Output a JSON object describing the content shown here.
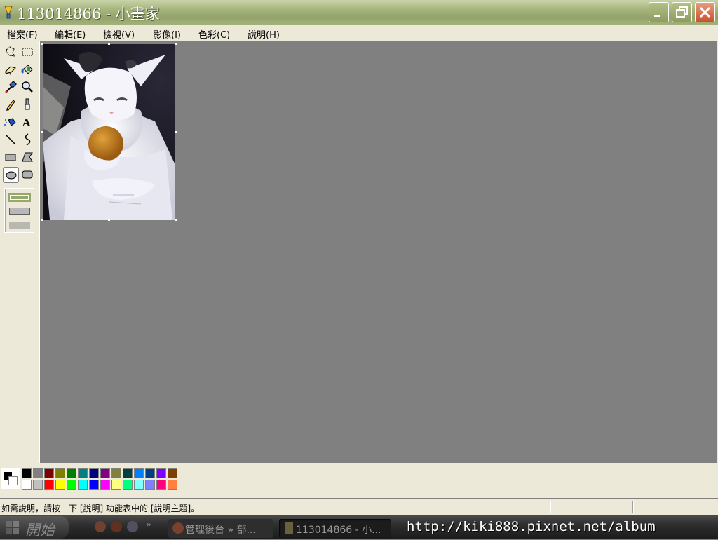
{
  "window": {
    "title": "113014866 - 小畫家"
  },
  "menu": [
    "檔案(F)",
    "編輯(E)",
    "檢視(V)",
    "影像(I)",
    "色彩(C)",
    "說明(H)"
  ],
  "tools": [
    "free-form-select",
    "rectangle-select",
    "eraser",
    "fill-with-color",
    "pick-color",
    "magnifier",
    "pencil",
    "brush",
    "airbrush",
    "text",
    "line",
    "curve",
    "rectangle",
    "polygon",
    "ellipse",
    "rounded-rectangle"
  ],
  "selected_tool": "ellipse",
  "canvas": {
    "image_subject": "white cat holding an orange ball",
    "background": "#808080"
  },
  "palette": {
    "foreground": "#000000",
    "background": "#ffffff",
    "top_row": [
      "#000000",
      "#808080",
      "#800000",
      "#808000",
      "#008000",
      "#008080",
      "#000080",
      "#800080",
      "#808040",
      "#004040",
      "#0080ff",
      "#004080",
      "#8000ff",
      "#804000"
    ],
    "bottom_row": [
      "#ffffff",
      "#c0c0c0",
      "#ff0000",
      "#ffff00",
      "#00ff00",
      "#00ffff",
      "#0000ff",
      "#ff00ff",
      "#ffff80",
      "#00ff80",
      "#80ffff",
      "#8080ff",
      "#ff0080",
      "#ff8040"
    ]
  },
  "status": {
    "text": "如需說明，請按一下 [說明] 功能表中的 [說明主題]。"
  },
  "taskbar": {
    "start": "開始",
    "tasks": [
      "管理後台 » 部...",
      "113014866 - 小..."
    ],
    "watermark": "http://kiki888.pixnet.net/album"
  },
  "colors": {
    "titlebar": "#a8b67f",
    "chrome": "#ece9d8",
    "workspace": "#808080"
  }
}
